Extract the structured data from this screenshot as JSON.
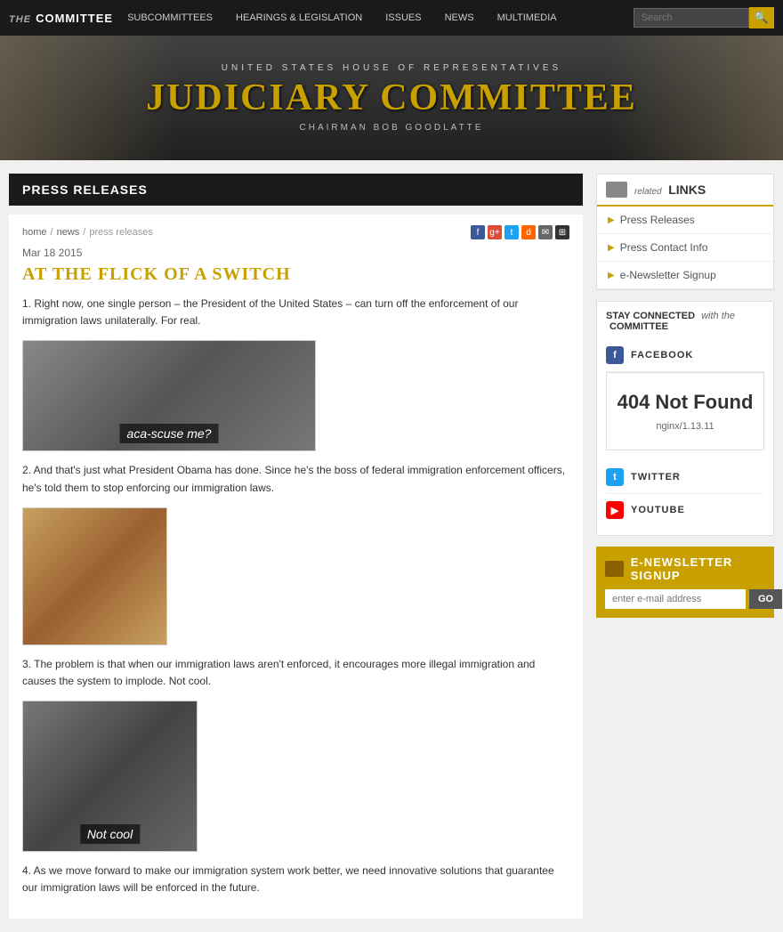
{
  "nav": {
    "logo_italic": "the",
    "logo_text": "COMMITTEE",
    "items": [
      "SUBCOMMITTEES",
      "HEARINGS & LEGISLATION",
      "ISSUES",
      "NEWS",
      "MULTIMEDIA"
    ],
    "search_placeholder": "Search"
  },
  "banner": {
    "subtitle": "UNITED STATES HOUSE of REPRESENTATIVES",
    "title": "JUDICIARY COMMITTEE",
    "chairman": "CHAIRMAN BOB GOODLATTE"
  },
  "section_header": "PRESS RELEASES",
  "breadcrumb": {
    "home": "home",
    "news": "news",
    "current": "press releases"
  },
  "article": {
    "date": "Mar 18 2015",
    "title": "AT THE FLICK OF A SWITCH",
    "para1": "1. Right now, one single person – the President of the United States – can turn off the enforcement of our immigration laws unilaterally. For real.",
    "img1_label": "aca-scuse me?",
    "para2": "2. And that's just what President Obama has done. Since he's the boss of federal immigration enforcement officers, he's told them to stop enforcing our immigration laws.",
    "para3": "3. The problem is that when our immigration laws aren't enforced, it encourages more illegal immigration and causes the system to implode. Not cool.",
    "img3_label": "Not cool",
    "para4": "4. As we move forward to make our immigration system work better, we need innovative solutions that guarantee our immigration laws will be enforced in the future."
  },
  "sidebar": {
    "related_links": {
      "icon_label": "related",
      "title": "LINKS",
      "items": [
        {
          "label": "Press Releases"
        },
        {
          "label": "Press Contact Info"
        },
        {
          "label": "e-Newsletter Signup"
        }
      ]
    },
    "stay_connected": {
      "prefix": "STAY CONNECTED",
      "italic": "with the",
      "committee": "COMMITTEE"
    },
    "facebook_label": "FACEBOOK",
    "twitter_label": "TWITTER",
    "youtube_label": "YOUTUBE",
    "not_found": {
      "title": "404 Not Found",
      "server": "nginx/1.13.11"
    },
    "newsletter": {
      "icon_label": "e-NEWSLETTER SIGNUP",
      "input_placeholder": "enter e-mail address",
      "go_label": "GO"
    }
  }
}
